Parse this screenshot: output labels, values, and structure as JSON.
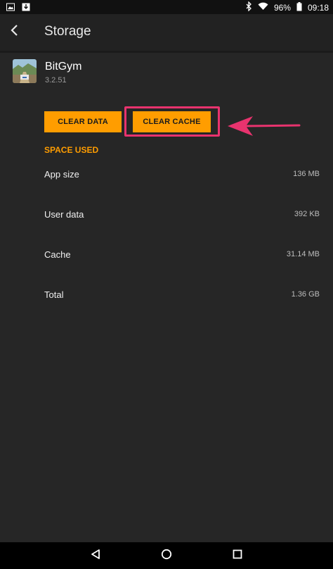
{
  "status_bar": {
    "battery": "96%",
    "time": "09:18",
    "icons": [
      "image-notification-icon",
      "download-notification-icon",
      "bluetooth-icon",
      "wifi-icon",
      "battery-icon"
    ]
  },
  "app_bar": {
    "title": "Storage",
    "back_icon": "back-arrow-icon"
  },
  "app_info": {
    "name": "BitGym",
    "version": "3.2.51"
  },
  "buttons": {
    "clear_data": "CLEAR DATA",
    "clear_cache": "CLEAR CACHE"
  },
  "section": {
    "title": "SPACE USED"
  },
  "storage_rows": [
    {
      "label": "App size",
      "value": "136 MB"
    },
    {
      "label": "User data",
      "value": "392 KB"
    },
    {
      "label": "Cache",
      "value": "31.14 MB"
    },
    {
      "label": "Total",
      "value": "1.36 GB"
    }
  ],
  "colors": {
    "accent": "#ff9d00",
    "highlight": "#e8336e",
    "background": "#262626"
  },
  "nav_bar": {
    "icons": [
      "back-triangle-icon",
      "home-circle-icon",
      "recents-square-icon"
    ]
  }
}
